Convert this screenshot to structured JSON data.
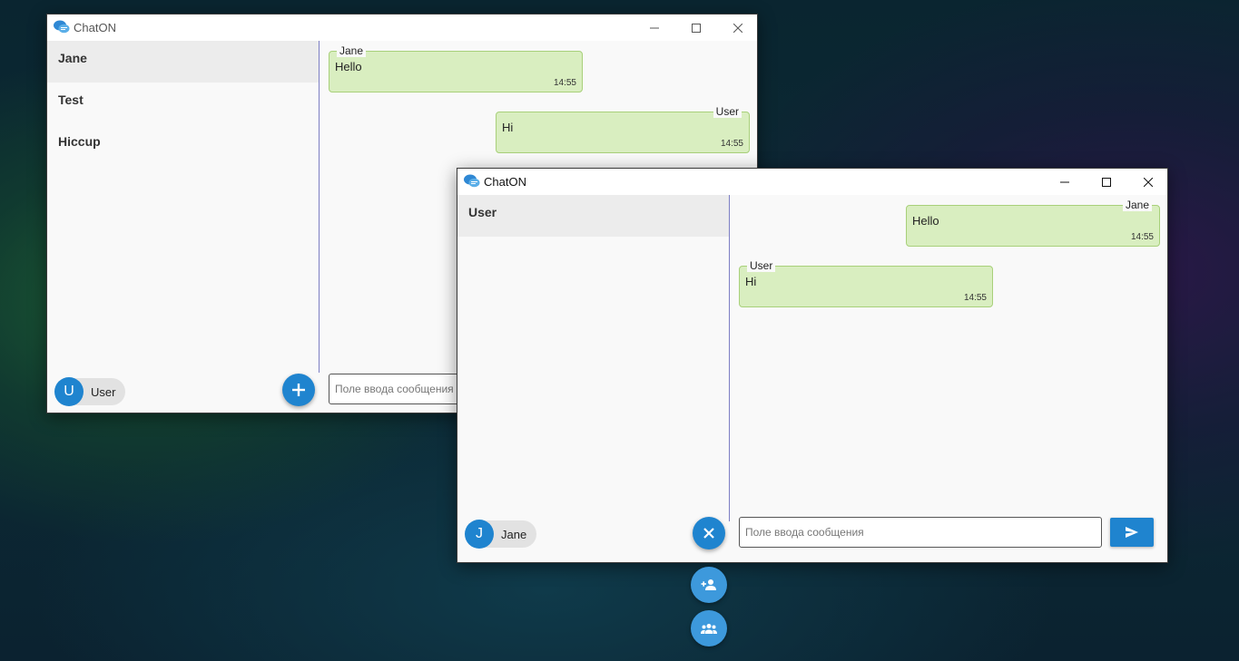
{
  "window1": {
    "title": "ChatON",
    "chats": [
      {
        "name": "Jane"
      },
      {
        "name": "Test"
      },
      {
        "name": "Hiccup"
      }
    ],
    "user": {
      "initial": "U",
      "name": "User"
    },
    "messages": [
      {
        "author": "Jane",
        "text": "Hello",
        "time": "14:55"
      },
      {
        "author": "User",
        "text": "Hi",
        "time": "14:55"
      }
    ],
    "input_placeholder": "Поле ввода сообщения"
  },
  "window2": {
    "title": "ChatON",
    "chats": [
      {
        "name": "User"
      }
    ],
    "user": {
      "initial": "J",
      "name": "Jane"
    },
    "messages": [
      {
        "author": "Jane",
        "text": "Hello",
        "time": "14:55"
      },
      {
        "author": "User",
        "text": "Hi",
        "time": "14:55"
      }
    ],
    "input_placeholder": "Поле ввода сообщения"
  },
  "icons": {
    "app": "chat-bubbles-icon",
    "minimize": "minimize-icon",
    "maximize": "maximize-icon",
    "close": "close-icon",
    "add": "plus-icon",
    "close_fab": "x-icon",
    "add_contact": "add-person-icon",
    "group": "group-icon",
    "send": "send-icon"
  },
  "colors": {
    "accent": "#1f84cf",
    "bubble": "#d9eec0",
    "bubble_border": "#a8d07a"
  }
}
